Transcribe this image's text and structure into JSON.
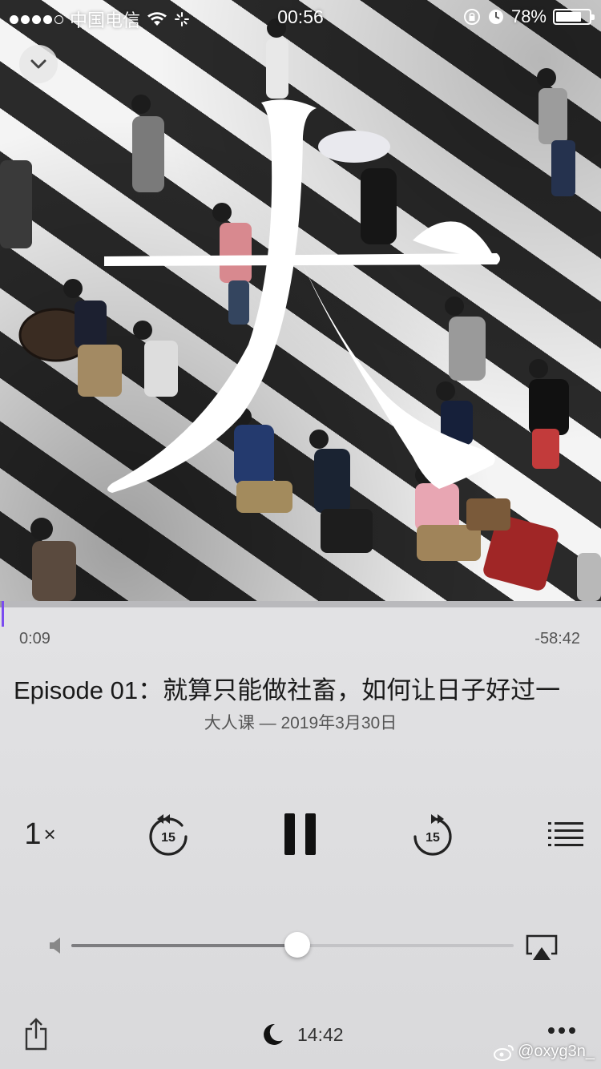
{
  "status_bar": {
    "carrier": "中国电信",
    "time": "00:56",
    "battery_percent": "78%",
    "battery_level": 0.78,
    "signal_bars_filled": 4,
    "icons": [
      "signal-dots-icon",
      "wifi-icon",
      "loading-icon",
      "rotation-lock-icon",
      "alarm-icon",
      "battery-icon"
    ]
  },
  "artwork": {
    "glyph": "大",
    "description_icon": "podcast-artwork"
  },
  "player": {
    "progress_fraction": 0.003,
    "time_elapsed": "0:09",
    "time_remaining": "-58:42",
    "episode_title": "Episode 01：就算只能做社畜，如何让日子好过一",
    "episode_meta": "大人课 — 2019年3月30日",
    "speed_value": "1",
    "speed_suffix": "×",
    "skip_seconds": "15",
    "volume_fraction": 0.51,
    "sleep_timer": "14:42",
    "accent_color": "#7b4cf0"
  },
  "watermark": {
    "handle": "@oxyg3n_",
    "icon": "weibo-icon"
  }
}
